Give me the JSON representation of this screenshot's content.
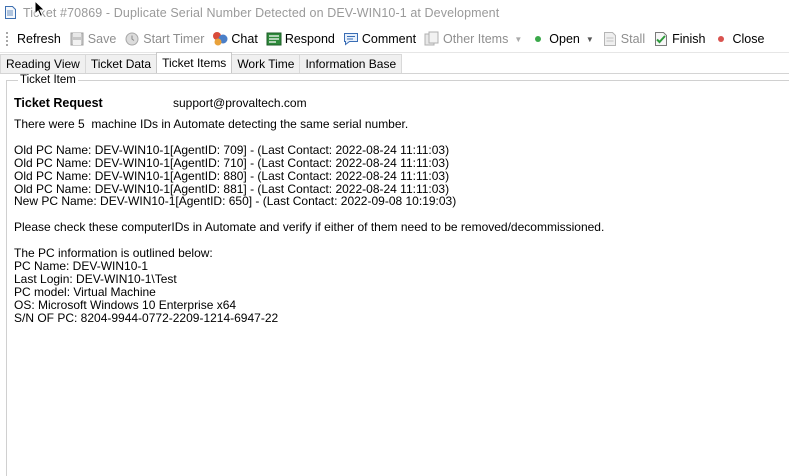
{
  "window": {
    "title": "Ticket #70869 - Duplicate Serial Number Detected on DEV-WIN10-1 at Development"
  },
  "toolbar": {
    "items": [
      {
        "label": "Refresh",
        "icon": "refresh-icon",
        "enabled": true
      },
      {
        "label": "Save",
        "icon": "save-icon",
        "enabled": false
      },
      {
        "label": "Start Timer",
        "icon": "timer-icon",
        "enabled": false
      },
      {
        "label": "Chat",
        "icon": "chat-icon",
        "enabled": true
      },
      {
        "label": "Respond",
        "icon": "respond-icon",
        "enabled": true
      },
      {
        "label": "Comment",
        "icon": "comment-icon",
        "enabled": true
      },
      {
        "label": "Other Items",
        "icon": "other-items-icon",
        "enabled": false,
        "dropdown": true
      },
      {
        "label": "Open",
        "icon": "status-dot-green-icon",
        "enabled": true,
        "dropdown": true
      },
      {
        "label": "Stall",
        "icon": "stall-icon",
        "enabled": false
      },
      {
        "label": "Finish",
        "icon": "finish-icon",
        "enabled": true
      },
      {
        "label": "Close",
        "icon": "status-dot-red-icon",
        "enabled": true
      }
    ]
  },
  "tabs": [
    {
      "label": "Reading View",
      "active": false
    },
    {
      "label": "Ticket Data",
      "active": false
    },
    {
      "label": "Ticket Items",
      "active": true
    },
    {
      "label": "Work Time",
      "active": false
    },
    {
      "label": "Information Base",
      "active": false
    }
  ],
  "ticket_item": {
    "group_label": "Ticket Item",
    "request_label": "Ticket Request",
    "request_email": "support@provaltech.com",
    "lines": [
      "There were 5  machine IDs in Automate detecting the same serial number.",
      "",
      "Old PC Name: DEV-WIN10-1[AgentID: 709] - (Last Contact: 2022-08-24 11:11:03)",
      "Old PC Name: DEV-WIN10-1[AgentID: 710] - (Last Contact: 2022-08-24 11:11:03)",
      "Old PC Name: DEV-WIN10-1[AgentID: 880] - (Last Contact: 2022-08-24 11:11:03)",
      "Old PC Name: DEV-WIN10-1[AgentID: 881] - (Last Contact: 2022-08-24 11:11:03)",
      "New PC Name: DEV-WIN10-1[AgentID: 650] - (Last Contact: 2022-09-08 10:19:03)",
      "",
      "Please check these computerIDs in Automate and verify if either of them need to be removed/decommissioned.",
      "",
      "The PC information is outlined below:",
      "PC Name: DEV-WIN10-1",
      "Last Login: DEV-WIN10-1\\Test",
      "PC model: Virtual Machine",
      "OS: Microsoft Windows 10 Enterprise x64",
      "S/N OF PC: 8204-9944-0772-2209-1214-6947-22"
    ]
  }
}
